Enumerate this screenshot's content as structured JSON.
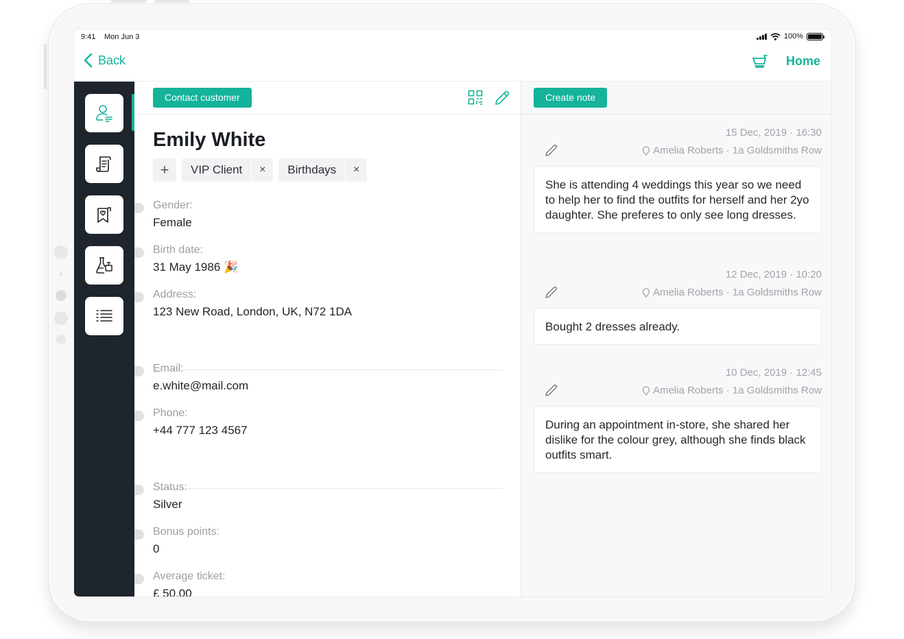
{
  "status_bar": {
    "time": "9:41",
    "date": "Mon Jun 3",
    "battery": "100%"
  },
  "nav": {
    "back_label": "Back",
    "home_label": "Home"
  },
  "sidebar": {
    "items": [
      {
        "icon": "customer-profile-icon",
        "active": true
      },
      {
        "icon": "receipt-icon",
        "active": false
      },
      {
        "icon": "wishlist-icon",
        "active": false
      },
      {
        "icon": "samples-icon",
        "active": false
      },
      {
        "icon": "list-icon",
        "active": false
      }
    ]
  },
  "customer": {
    "contact_button": "Contact customer",
    "name": "Emily White",
    "tags": [
      "VIP Client",
      "Birthdays"
    ],
    "add_tag_glyph": "+",
    "remove_tag_glyph": "×",
    "fields": {
      "gender": {
        "label": "Gender:",
        "value": "Female"
      },
      "birth_date": {
        "label": "Birth date:",
        "value": "31 May 1986 🎉"
      },
      "address": {
        "label": "Address:",
        "value": "123 New Road, London, UK, N72 1DA"
      },
      "email": {
        "label": "Email:",
        "value": "e.white@mail.com"
      },
      "phone": {
        "label": "Phone:",
        "value": "+44 777 123 4567"
      },
      "status": {
        "label": "Status:",
        "value": "Silver"
      },
      "bonus_points": {
        "label": "Bonus points:",
        "value": "0"
      },
      "average_ticket": {
        "label": "Average ticket:",
        "value": "£ 50.00"
      }
    }
  },
  "notes": {
    "create_button": "Create note",
    "items": [
      {
        "datetime": "15 Dec, 2019 · 16:30",
        "author_location": "Amelia Roberts · 1a Goldsmiths Row",
        "text": "She is attending 4 weddings this year so we need to help her to find the outfits for herself and her 2yo daughter. She preferes to only see long dresses."
      },
      {
        "datetime": "12 Dec, 2019 · 10:20",
        "author_location": "Amelia Roberts · 1a Goldsmiths Row",
        "text": "Bought 2 dresses already."
      },
      {
        "datetime": "10 Dec, 2019 · 12:45",
        "author_location": "Amelia Roberts · 1a Goldsmiths Row",
        "text": "During an appointment in-store, she shared her dislike for the colour grey, although she finds black outfits smart."
      }
    ]
  },
  "colors": {
    "accent": "#14b39a",
    "sidebar_bg": "#1f252d"
  }
}
